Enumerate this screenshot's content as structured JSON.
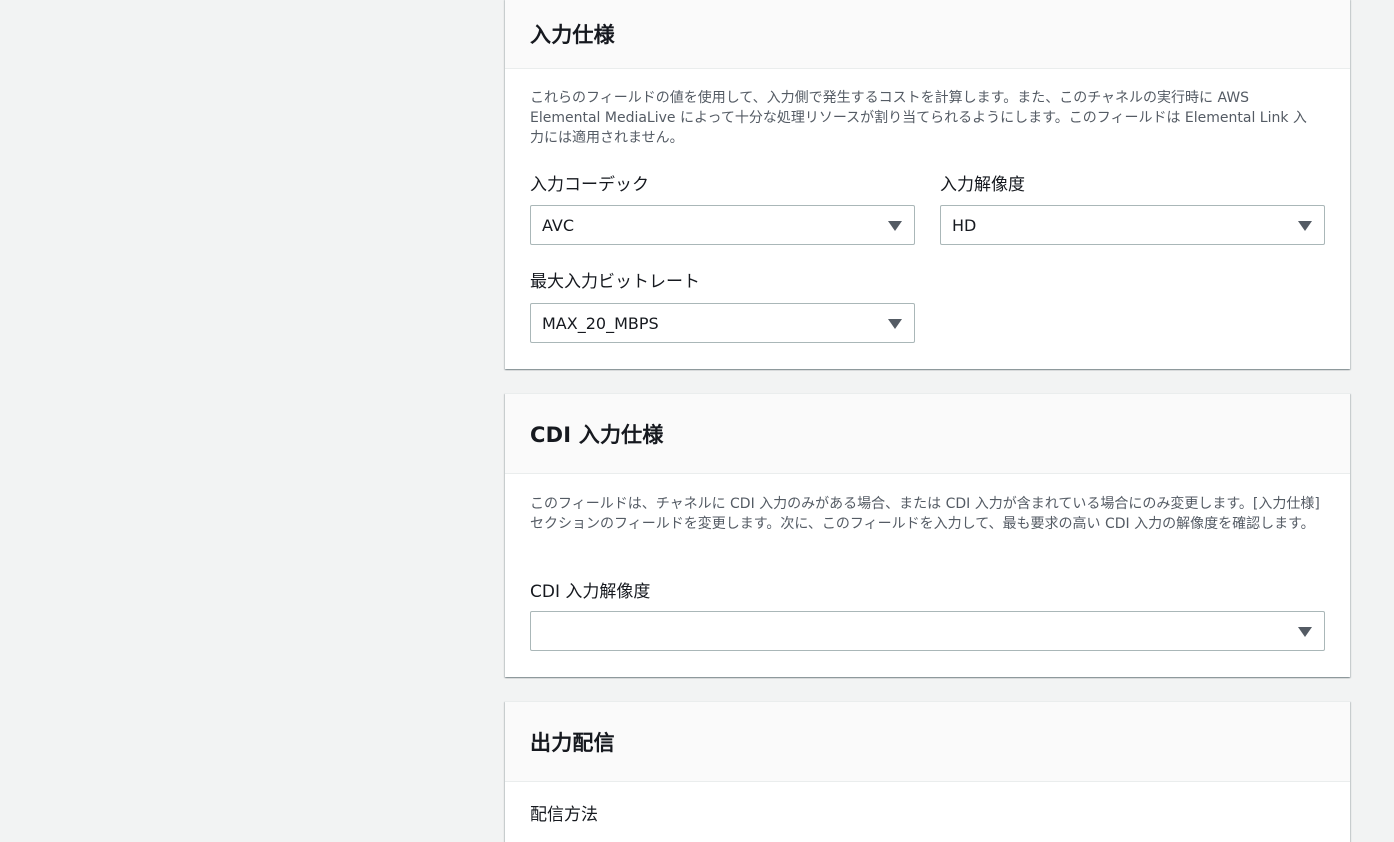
{
  "input_spec": {
    "title": "入力仕様",
    "description": "これらのフィールドの値を使用して、入力側で発生するコストを計算します。また、このチャネルの実行時に AWS Elemental MediaLive によって十分な処理リソースが割り当てられるようにします。このフィールドは Elemental Link 入力には適用されません。",
    "codec_label": "入力コーデック",
    "codec_value": "AVC",
    "resolution_label": "入力解像度",
    "resolution_value": "HD",
    "bitrate_label": "最大入力ビットレート",
    "bitrate_value": "MAX_20_MBPS"
  },
  "cdi_spec": {
    "title": "CDI 入力仕様",
    "description": "このフィールドは、チャネルに CDI 入力のみがある場合、または CDI 入力が含まれている場合にのみ変更します。[入力仕様] セクションのフィールドを変更します。次に、このフィールドを入力して、最も要求の高い CDI 入力の解像度を確認します。",
    "resolution_label": "CDI 入力解像度",
    "resolution_value": ""
  },
  "output_delivery": {
    "title": "出力配信",
    "method_label": "配信方法"
  }
}
